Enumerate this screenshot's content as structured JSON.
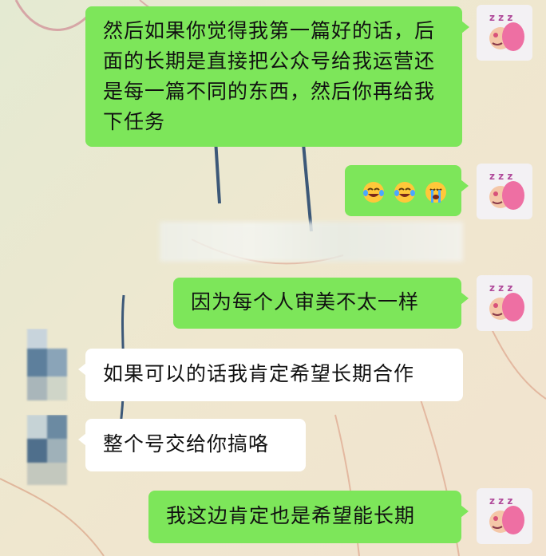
{
  "messages": [
    {
      "side": "right",
      "text": "然后如果你觉得我第一篇好的话，后面的长期是直接把公众号给我运营还是每一篇不同的东西，然后你再给我下任务"
    },
    {
      "side": "right",
      "emoji": [
        "crying-laughing",
        "crying-laughing",
        "loudly-crying"
      ]
    },
    {
      "side": "right",
      "text": "因为每个人审美不太一样"
    },
    {
      "side": "left",
      "text": "如果可以的话我肯定希望长期合作"
    },
    {
      "side": "left",
      "text": "整个号交给你搞咯"
    },
    {
      "side": "right",
      "text": "我这边肯定也是希望能长期"
    }
  ],
  "colors": {
    "sent_bubble": "#7de65a",
    "received_bubble": "#ffffff",
    "background": "#e9e6d0"
  },
  "avatars": {
    "self": "sleeping-pink-character-avatar-icon",
    "other": "pixelated-avatar"
  }
}
